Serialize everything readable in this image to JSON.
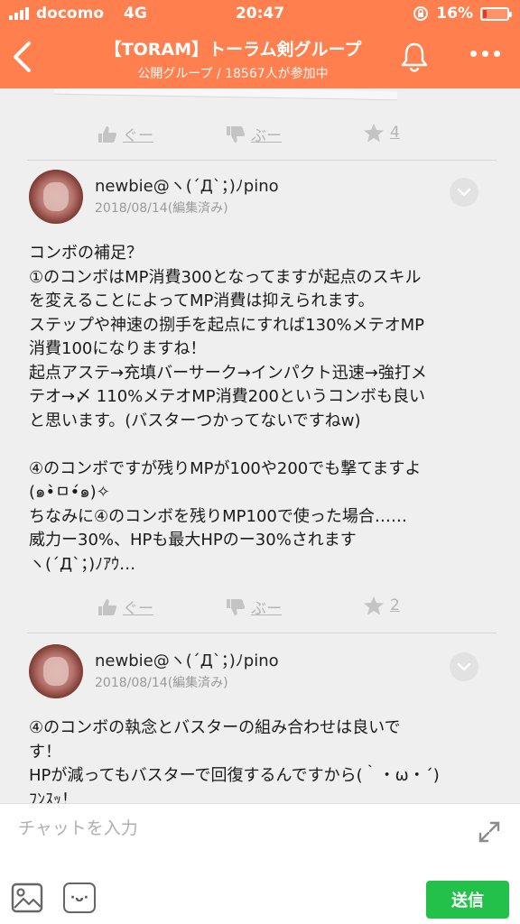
{
  "status_bar": {
    "carrier": "docomo",
    "network": "4G",
    "time": "20:47",
    "battery": "16%",
    "battery_level": 0.16
  },
  "header": {
    "title": "【TORAM】トーラム剣グループ",
    "subtitle": "公開グループ / 18567人が参加中"
  },
  "feed": {
    "top_reactions": {
      "good": "ぐー",
      "boo": "ぶー",
      "star_count": "4"
    },
    "posts": [
      {
        "author": "newbie@ヽ(´Д`；)ﾉpino",
        "date": "2018/08/14(編集済み)",
        "lines": [
          "コンボの補足？",
          "①のコンボはMP消費300となってますが起点のスキル",
          "を変えることによってMP消費は抑えられます。",
          "ステップや神速の捌手を起点にすれば130%メテオMP",
          "消費100になりますね！",
          "起点アステ→充填バーサーク→インパクト迅速→強打メ",
          "テオ→〆 110%メテオMP消費200というコンボも良い",
          "と思います。(バスターつかってないですねw)",
          "",
          "④のコンボですが残りMPが100や200でも撃てますよ",
          "(๑•̀ㅁ•́๑)✧",
          "ちなみに④のコンボを残りMP100で使った場合……",
          "威力ー30%、HPも最大HPのー30%されます",
          "ヽ(´Д`；)ﾉｱｳ…"
        ],
        "reactions": {
          "good": "ぐー",
          "boo": "ぶー",
          "star_count": "2"
        }
      },
      {
        "author": "newbie@ヽ(´Д`；)ﾉpino",
        "date": "2018/08/14(編集済み)",
        "lines": [
          "④のコンボの執念とバスターの組み合わせは良いで",
          "す！",
          "HPが減ってもバスターで回復するんですから(｀・ω・´)",
          "ﾌﾝｽｯ！"
        ]
      }
    ]
  },
  "input_bar": {
    "placeholder": "チャットを入力",
    "sticker_face": "·ᴗ·",
    "send_label": "送信"
  },
  "colors": {
    "header": "#ff7f4f",
    "send": "#23c04a",
    "battery_low": "#e23a2e"
  },
  "icons": [
    "back-icon",
    "bell-icon",
    "more-icon",
    "thumbs-up-icon",
    "thumbs-down-icon",
    "star-icon",
    "chevron-down-icon",
    "expand-icon",
    "image-icon",
    "sticker-icon"
  ]
}
